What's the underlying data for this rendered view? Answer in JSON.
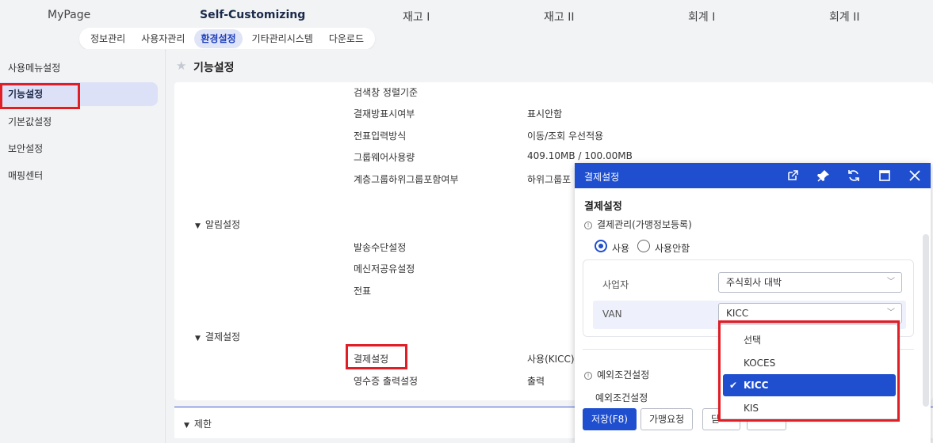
{
  "topnav": {
    "items": [
      "MyPage",
      "Self-Customizing",
      "재고 I",
      "재고 II",
      "회계 I",
      "회계 II"
    ]
  },
  "subtabs": [
    "정보관리",
    "사용자관리",
    "환경설정",
    "기타관리시스템",
    "다운로드"
  ],
  "sidebar": {
    "items": [
      "사용메뉴설정",
      "기능설정",
      "기본값설정",
      "보안설정",
      "매핑센터"
    ]
  },
  "main": {
    "title": "기능설정",
    "rows": [
      {
        "label": "검색창 정렬기준",
        "value": ""
      },
      {
        "label": "결재방표시여부",
        "value": "표시안함"
      },
      {
        "label": "전표입력방식",
        "value": "이동/조회 우선적용"
      },
      {
        "label": "그룹웨어사용량",
        "value": "409.10MB / 100.00MB"
      },
      {
        "label": "계층그룹하위그룹포함여부",
        "value": "하위그룹포"
      }
    ],
    "section_alarm": "알림설정",
    "alarm_rows": [
      "발송수단설정",
      "메신저공유설정",
      "전표"
    ],
    "section_payment": "결제설정",
    "payment_rows": [
      {
        "label": "결제설정",
        "value": "사용(KICC)"
      },
      {
        "label": "영수증 출력설정",
        "value": "출력"
      }
    ],
    "section_limit": "제한"
  },
  "dialog": {
    "title": "결제설정",
    "heading": "결제설정",
    "subheading": "결제관리(가맹정보등록)",
    "radio_use": "사용",
    "radio_nouse": "사용안함",
    "business_label": "사업자",
    "business_value": "주식회사 대박",
    "van_label": "VAN",
    "van_value": "KICC",
    "exception_heading": "예외조건설정",
    "exception_label": "예외조건설정",
    "dropdown_options": [
      "선택",
      "KOCES",
      "KICC",
      "KIS"
    ],
    "btn_save": "저장(F8)",
    "btn_request": "가맹요청",
    "btn_other": "닫",
    "colors": {
      "accent": "#1f4fcf",
      "highlight_box": "#e01e26"
    }
  }
}
